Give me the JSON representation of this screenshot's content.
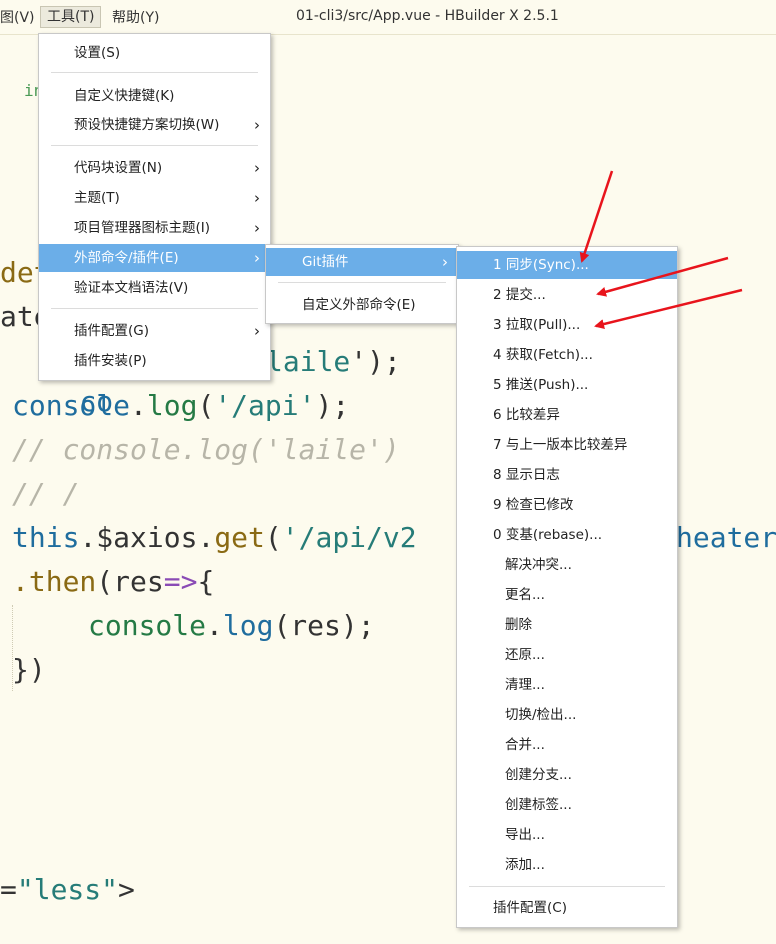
{
  "menubar": {
    "view": "图(V)",
    "tools": "工具(T)",
    "help": "帮助(Y)"
  },
  "window_title": "01-cli3/src/App.vue - HBuilder X 2.5.1",
  "code": {
    "frag_in": "in",
    "frag_det": "det",
    "frag_ate": "ate",
    "l1_obj": "co",
    "l1_str": "laile",
    "l1_end": "');",
    "l2_obj": "console",
    "l2_dot": ".",
    "l2_fn": "log",
    "l2_open": "(",
    "l2_str": "'/api'",
    "l2_end": ");",
    "l3": "// console.log('laile')",
    "l4": "// /",
    "l5_this": "this",
    "l5_dot": ".",
    "l5_axios": "$axios",
    "l5_dot2": ".",
    "l5_get": "get",
    "l5_open": "(",
    "l5_str": "'/api/v2",
    "l5_tail": "heater",
    "l6_then": ".then",
    "l6_rest": "(res",
    "l6_arrow": "=>",
    "l6_brace": "{",
    "l7_obj": "console",
    "l7_dot": ".",
    "l7_fn": "log",
    "l7_rest": "(res);",
    "l8": "})",
    "l9_eq": "=",
    "l9_str": "\"less\"",
    "l9_end": ">"
  },
  "tools_menu": {
    "items": [
      "设置(S)",
      "自定义快捷键(K)",
      "预设快捷键方案切换(W)",
      "代码块设置(N)",
      "主题(T)",
      "项目管理器图标主题(I)",
      "外部命令/插件(E)",
      "验证本文档语法(V)",
      "插件配置(G)",
      "插件安装(P)"
    ]
  },
  "ext_menu": {
    "items": [
      "Git插件",
      "自定义外部命令(E)"
    ]
  },
  "git_menu": {
    "items": [
      "1 同步(Sync)...",
      "2 提交...",
      "3 拉取(Pull)...",
      "4 获取(Fetch)...",
      "5 推送(Push)...",
      "6 比较差异",
      "7 与上一版本比较差异",
      "8 显示日志",
      "9 检查已修改",
      "0 变基(rebase)...",
      "解决冲突...",
      "更名...",
      "删除",
      "还原...",
      "清理...",
      "切换/检出...",
      "合并...",
      "创建分支...",
      "创建标签...",
      "导出...",
      "添加...",
      "插件配置(C)"
    ]
  },
  "icons": {
    "submenu": "chevron-right-icon",
    "annotation": "red-arrow-icon"
  },
  "colors": {
    "highlight": "#6baee8",
    "annotation": "#e8141c",
    "background": "#fdfbee"
  }
}
